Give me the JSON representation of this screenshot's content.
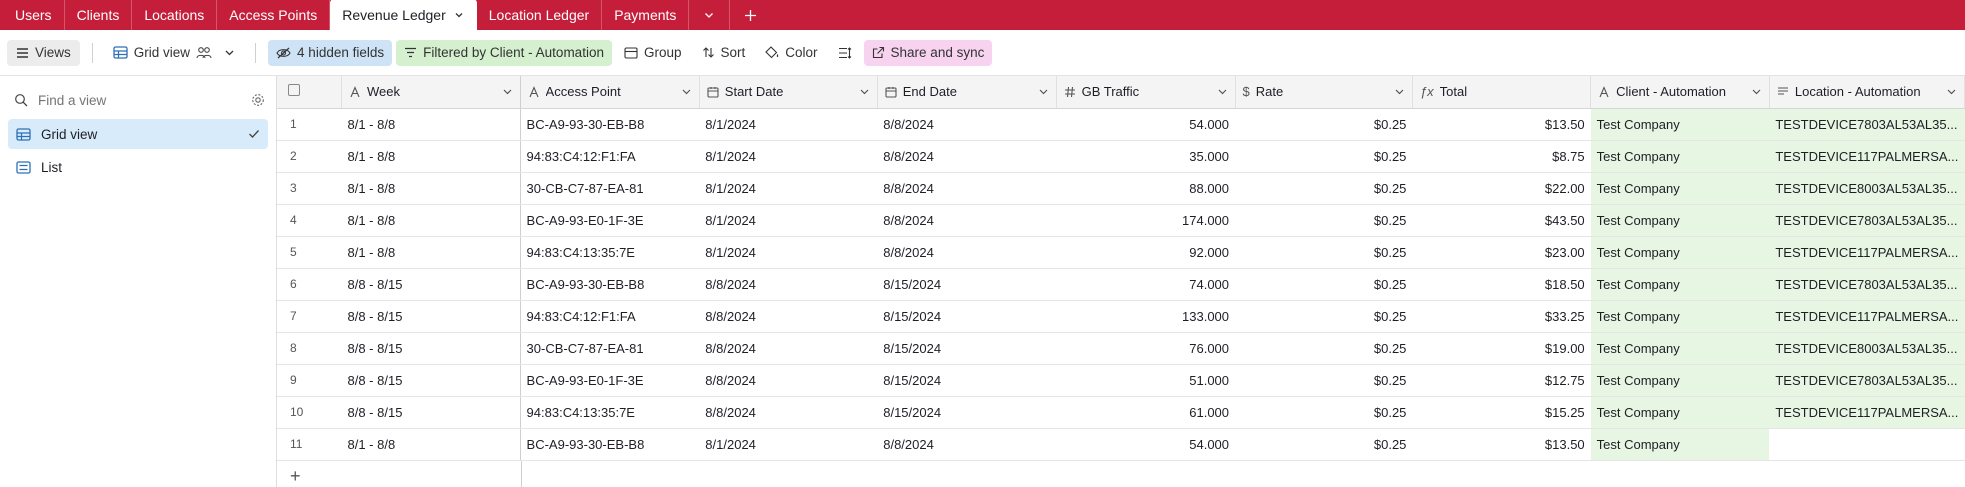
{
  "tabs": [
    {
      "label": "Users",
      "active": false
    },
    {
      "label": "Clients",
      "active": false
    },
    {
      "label": "Locations",
      "active": false
    },
    {
      "label": "Access Points",
      "active": false
    },
    {
      "label": "Revenue Ledger",
      "active": true
    },
    {
      "label": "Location Ledger",
      "active": false
    },
    {
      "label": "Payments",
      "active": false
    }
  ],
  "toolbar": {
    "views_label": "Views",
    "view_name": "Grid view",
    "hidden_fields": "4 hidden fields",
    "filter": "Filtered by Client - Automation",
    "group": "Group",
    "sort": "Sort",
    "color": "Color",
    "share": "Share and sync"
  },
  "sidebar": {
    "find_placeholder": "Find a view",
    "views": [
      {
        "label": "Grid view",
        "icon": "grid-icon",
        "active": true
      },
      {
        "label": "List",
        "icon": "list-icon",
        "active": false
      }
    ]
  },
  "columns": [
    "Week",
    "Access Point",
    "Start Date",
    "End Date",
    "GB Traffic",
    "Rate",
    "Total",
    "Client - Automation",
    "Location - Automation"
  ],
  "rows": [
    {
      "n": "1",
      "week": "8/1 - 8/8",
      "ap": "BC-A9-93-30-EB-B8",
      "start": "8/1/2024",
      "end": "8/8/2024",
      "gb": "54.000",
      "rate": "$0.25",
      "total": "$13.50",
      "client": "Test Company",
      "loc": "TESTDEVICE7803AL53AL35..."
    },
    {
      "n": "2",
      "week": "8/1 - 8/8",
      "ap": "94:83:C4:12:F1:FA",
      "start": "8/1/2024",
      "end": "8/8/2024",
      "gb": "35.000",
      "rate": "$0.25",
      "total": "$8.75",
      "client": "Test Company",
      "loc": "TESTDEVICE117PALMERSA..."
    },
    {
      "n": "3",
      "week": "8/1 - 8/8",
      "ap": "30-CB-C7-87-EA-81",
      "start": "8/1/2024",
      "end": "8/8/2024",
      "gb": "88.000",
      "rate": "$0.25",
      "total": "$22.00",
      "client": "Test Company",
      "loc": "TESTDEVICE8003AL53AL35..."
    },
    {
      "n": "4",
      "week": "8/1 - 8/8",
      "ap": "BC-A9-93-E0-1F-3E",
      "start": "8/1/2024",
      "end": "8/8/2024",
      "gb": "174.000",
      "rate": "$0.25",
      "total": "$43.50",
      "client": "Test Company",
      "loc": "TESTDEVICE7803AL53AL35..."
    },
    {
      "n": "5",
      "week": "8/1 - 8/8",
      "ap": "94:83:C4:13:35:7E",
      "start": "8/1/2024",
      "end": "8/8/2024",
      "gb": "92.000",
      "rate": "$0.25",
      "total": "$23.00",
      "client": "Test Company",
      "loc": "TESTDEVICE117PALMERSA..."
    },
    {
      "n": "6",
      "week": "8/8 - 8/15",
      "ap": "BC-A9-93-30-EB-B8",
      "start": "8/8/2024",
      "end": "8/15/2024",
      "gb": "74.000",
      "rate": "$0.25",
      "total": "$18.50",
      "client": "Test Company",
      "loc": "TESTDEVICE7803AL53AL35..."
    },
    {
      "n": "7",
      "week": "8/8 - 8/15",
      "ap": "94:83:C4:12:F1:FA",
      "start": "8/8/2024",
      "end": "8/15/2024",
      "gb": "133.000",
      "rate": "$0.25",
      "total": "$33.25",
      "client": "Test Company",
      "loc": "TESTDEVICE117PALMERSA..."
    },
    {
      "n": "8",
      "week": "8/8 - 8/15",
      "ap": "30-CB-C7-87-EA-81",
      "start": "8/8/2024",
      "end": "8/15/2024",
      "gb": "76.000",
      "rate": "$0.25",
      "total": "$19.00",
      "client": "Test Company",
      "loc": "TESTDEVICE8003AL53AL35..."
    },
    {
      "n": "9",
      "week": "8/8 - 8/15",
      "ap": "BC-A9-93-E0-1F-3E",
      "start": "8/8/2024",
      "end": "8/15/2024",
      "gb": "51.000",
      "rate": "$0.25",
      "total": "$12.75",
      "client": "Test Company",
      "loc": "TESTDEVICE7803AL53AL35..."
    },
    {
      "n": "10",
      "week": "8/8 - 8/15",
      "ap": "94:83:C4:13:35:7E",
      "start": "8/8/2024",
      "end": "8/15/2024",
      "gb": "61.000",
      "rate": "$0.25",
      "total": "$15.25",
      "client": "Test Company",
      "loc": "TESTDEVICE117PALMERSA..."
    },
    {
      "n": "11",
      "week": "8/1 - 8/8",
      "ap": "BC-A9-93-30-EB-B8",
      "start": "8/1/2024",
      "end": "8/8/2024",
      "gb": "54.000",
      "rate": "$0.25",
      "total": "$13.50",
      "client": "Test Company",
      "loc": ""
    }
  ],
  "add_row_label": "+",
  "colors": {
    "brand": "#c41e3a",
    "client_cell": "#e6f6e3",
    "active_view": "#d8ebfb"
  }
}
